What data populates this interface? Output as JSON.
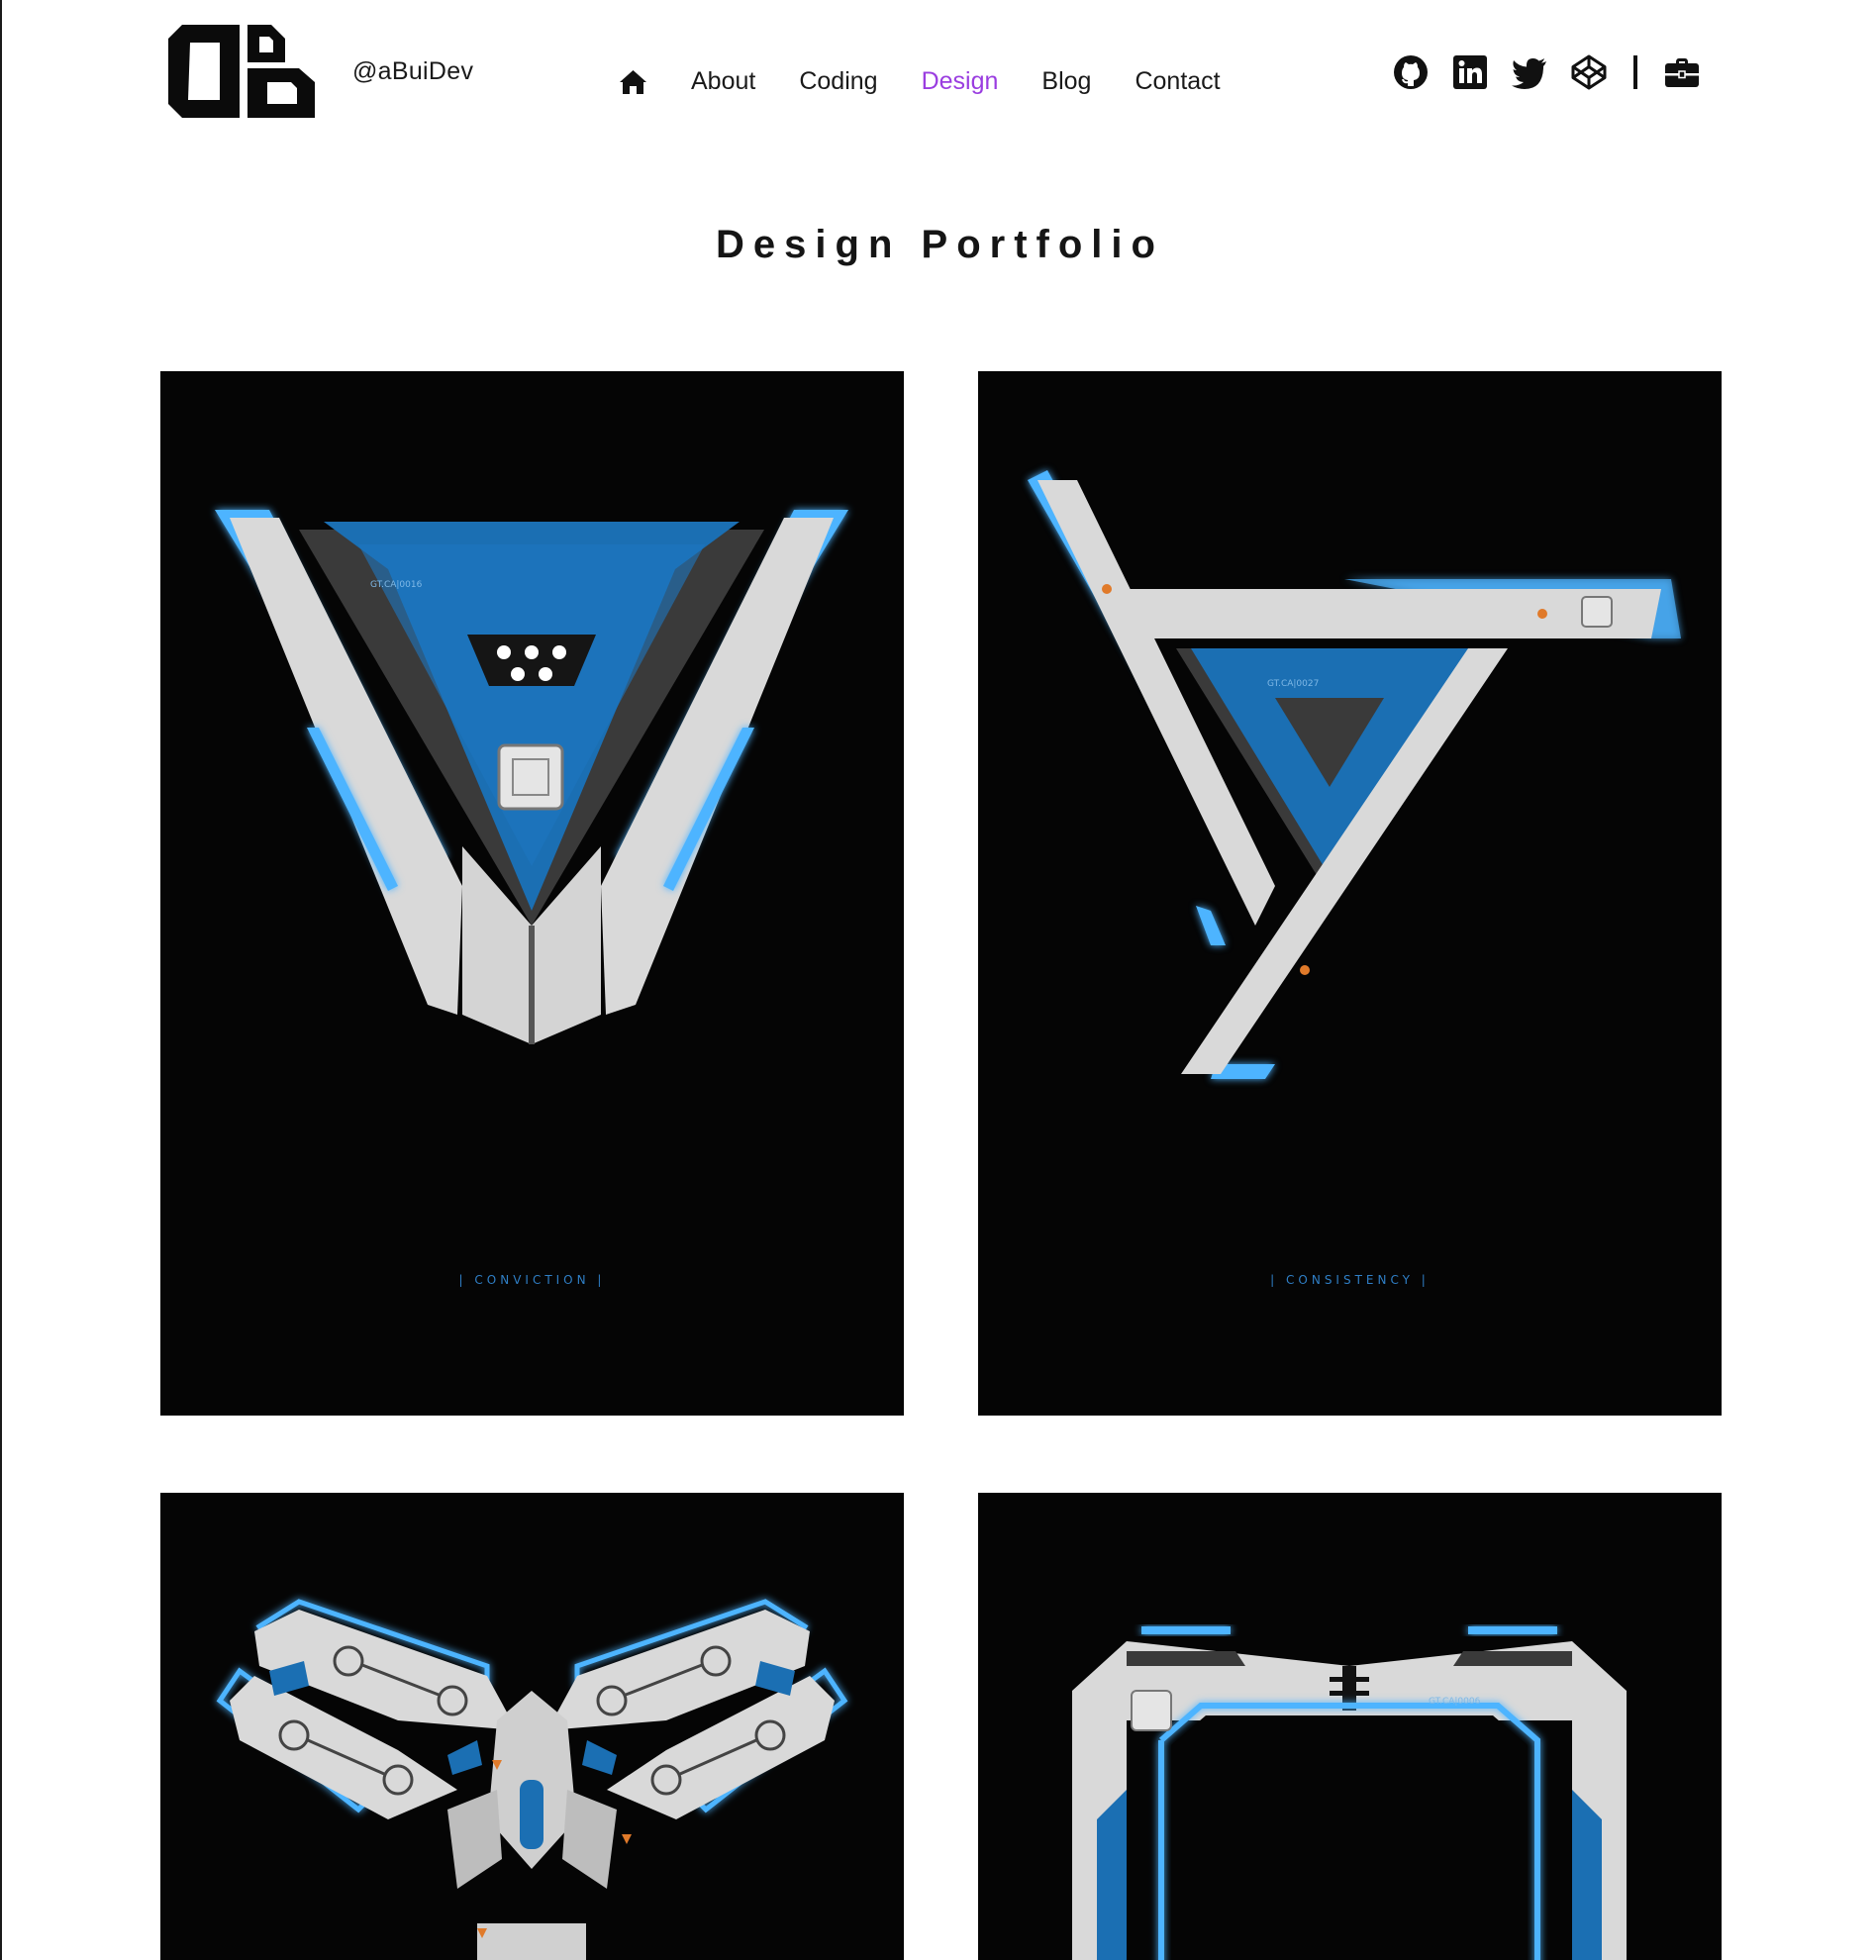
{
  "site": {
    "handle": "@aBuiDev",
    "logo_icon": "ab-logo-icon"
  },
  "nav": {
    "home_icon": "home-icon",
    "items": [
      {
        "label": "About",
        "active": false
      },
      {
        "label": "Coding",
        "active": false
      },
      {
        "label": "Design",
        "active": true
      },
      {
        "label": "Blog",
        "active": false
      },
      {
        "label": "Contact",
        "active": false
      }
    ],
    "active_color": "#9a3de0"
  },
  "social": {
    "icons": [
      "github-icon",
      "linkedin-icon",
      "twitter-icon",
      "codepen-icon",
      "briefcase-icon"
    ]
  },
  "page": {
    "title": "Design Portfolio"
  },
  "gallery": {
    "items": [
      {
        "caption": "| CONVICTION |",
        "code": "GT.CA|0016"
      },
      {
        "caption": "| CONSISTENCY |",
        "code": "GT.CA|0027"
      },
      {
        "caption": "",
        "code": ""
      },
      {
        "caption": "",
        "code": "GT.CA|0006"
      }
    ],
    "colors": {
      "background": "#050505",
      "panel_blue": "#1b6fb3",
      "glow_blue": "#4db4ff",
      "metal": "#d9d9d9",
      "dark_metal": "#3a3a3a",
      "accent_orange": "#e07a2a"
    }
  }
}
